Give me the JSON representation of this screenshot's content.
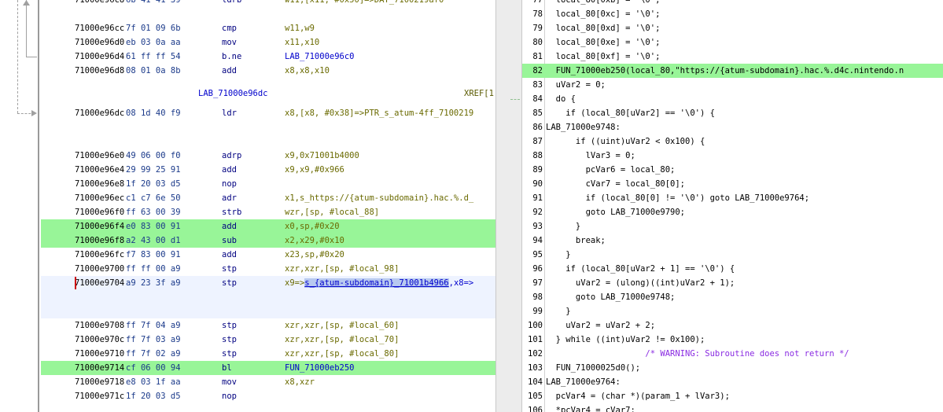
{
  "listing": {
    "rows": [
      {
        "addr": "71000e96c8",
        "bytes": "6b 41 41 39",
        "mn": "ldrb",
        "ops": "w11,[x11, #0x50]=>DAT_7100219af0",
        "hl": false
      },
      {
        "addr": "",
        "bytes": "",
        "mn": "",
        "ops": "",
        "hl": false
      },
      {
        "addr": "71000e96cc",
        "bytes": "7f 01 09 6b",
        "mn": "cmp",
        "ops": "w11,w9",
        "hl": false
      },
      {
        "addr": "71000e96d0",
        "bytes": "eb 03 0a aa",
        "mn": "mov",
        "ops": "x11,x10",
        "hl": false
      },
      {
        "addr": "71000e96d4",
        "bytes": "61 ff ff 54",
        "mn": "b.ne",
        "ops": "LAB_71000e96c0",
        "hl": false
      },
      {
        "addr": "71000e96d8",
        "bytes": "08 01 0a 8b",
        "mn": "add",
        "ops": "x8,x8,x10",
        "hl": false
      },
      {
        "addr": "",
        "bytes": "",
        "mn": "",
        "ops": "",
        "hl": false
      },
      {
        "addr": "",
        "bytes": "",
        "mn": "",
        "ops": "",
        "hl": false
      },
      {
        "addr": "71000e96dc",
        "bytes": "08 1d 40 f9",
        "mn": "ldr",
        "ops": "x8,[x8, #0x38]=>PTR_s_atum-4ff_7100219",
        "hl": false
      },
      {
        "addr": "",
        "bytes": "",
        "mn": "",
        "ops": "",
        "hl": false
      },
      {
        "addr": "",
        "bytes": "",
        "mn": "",
        "ops": "",
        "hl": false
      },
      {
        "addr": "71000e96e0",
        "bytes": "49 06 00 f0",
        "mn": "adrp",
        "ops": "x9,0x71001b4000",
        "hl": false
      },
      {
        "addr": "71000e96e4",
        "bytes": "29 99 25 91",
        "mn": "add",
        "ops": "x9,x9,#0x966",
        "hl": false
      },
      {
        "addr": "71000e96e8",
        "bytes": "1f 20 03 d5",
        "mn": "nop",
        "ops": "",
        "hl": false
      },
      {
        "addr": "71000e96ec",
        "bytes": "c1 c7 6e 50",
        "mn": "adr",
        "ops": "x1,s_https://{atum-subdomain}.hac.%.d_",
        "hl": false
      },
      {
        "addr": "71000e96f0",
        "bytes": "ff 63 00 39",
        "mn": "strb",
        "ops": "wzr,[sp, #local_88]",
        "hl": false
      },
      {
        "addr": "71000e96f4",
        "bytes": "e0 83 00 91",
        "mn": "add",
        "ops": "x0,sp,#0x20",
        "hl": true
      },
      {
        "addr": "71000e96f8",
        "bytes": "a2 43 00 d1",
        "mn": "sub",
        "ops": "x2,x29,#0x10",
        "hl": true
      },
      {
        "addr": "71000e96fc",
        "bytes": "f7 83 00 91",
        "mn": "add",
        "ops": "x23,sp,#0x20",
        "hl": false
      },
      {
        "addr": "71000e9700",
        "bytes": "ff ff 00 a9",
        "mn": "stp",
        "ops": "xzr,xzr,[sp, #local_98]",
        "hl": false
      },
      {
        "addr": "71000e9704",
        "bytes": "a9 23 3f a9",
        "mn": "stp",
        "ops": "",
        "hl": false
      },
      {
        "addr": "",
        "bytes": "",
        "mn": "",
        "ops": "",
        "hl": false
      },
      {
        "addr": "",
        "bytes": "",
        "mn": "",
        "ops": "",
        "hl": false
      },
      {
        "addr": "71000e9708",
        "bytes": "ff 7f 04 a9",
        "mn": "stp",
        "ops": "xzr,xzr,[sp, #local_60]",
        "hl": false
      },
      {
        "addr": "71000e970c",
        "bytes": "ff 7f 03 a9",
        "mn": "stp",
        "ops": "xzr,xzr,[sp, #local_70]",
        "hl": false
      },
      {
        "addr": "71000e9710",
        "bytes": "ff 7f 02 a9",
        "mn": "stp",
        "ops": "xzr,xzr,[sp, #local_80]",
        "hl": false
      },
      {
        "addr": "71000e9714",
        "bytes": "cf 06 00 94",
        "mn": "bl",
        "ops": "FUN_71000eb250",
        "hl": true
      },
      {
        "addr": "71000e9718",
        "bytes": "e8 03 1f aa",
        "mn": "mov",
        "ops": "x8,xzr",
        "hl": false
      },
      {
        "addr": "71000e971c",
        "bytes": "1f 20 03 d5",
        "mn": "nop",
        "ops": "",
        "hl": false
      }
    ],
    "label_row": {
      "label": "LAB_71000e96dc",
      "xref": "XREF[1"
    },
    "stp_row": {
      "pre": "x9=>",
      "sel": "s_{atum-subdomain}_71001b4966",
      "post": ",x8=>"
    }
  },
  "decompile": {
    "lines": [
      {
        "n": "77",
        "text": "  local_80[0xb] = '\\0';",
        "hl": false
      },
      {
        "n": "78",
        "text": "  local_80[0xc] = '\\0';",
        "hl": false
      },
      {
        "n": "79",
        "text": "  local_80[0xd] = '\\0';",
        "hl": false
      },
      {
        "n": "80",
        "text": "  local_80[0xe] = '\\0';",
        "hl": false
      },
      {
        "n": "81",
        "text": "  local_80[0xf] = '\\0';",
        "hl": false
      },
      {
        "n": "82",
        "text": "  FUN_71000eb250(local_80,\"https://{atum-subdomain}.hac.%.d4c.nintendo.n",
        "hl": true
      },
      {
        "n": "83",
        "text": "  uVar2 = 0;",
        "hl": false
      },
      {
        "n": "84",
        "text": "  do {",
        "hl": false
      },
      {
        "n": "85",
        "text": "    if (local_80[uVar2] == '\\0') {",
        "hl": false
      },
      {
        "n": "86",
        "text": "LAB_71000e9748:",
        "hl": false
      },
      {
        "n": "87",
        "text": "      if ((uint)uVar2 < 0x100) {",
        "hl": false
      },
      {
        "n": "88",
        "text": "        lVar3 = 0;",
        "hl": false
      },
      {
        "n": "89",
        "text": "        pcVar6 = local_80;",
        "hl": false
      },
      {
        "n": "90",
        "text": "        cVar7 = local_80[0];",
        "hl": false
      },
      {
        "n": "91",
        "text": "        if (local_80[0] != '\\0') goto LAB_71000e9764;",
        "hl": false
      },
      {
        "n": "92",
        "text": "        goto LAB_71000e9790;",
        "hl": false
      },
      {
        "n": "93",
        "text": "      }",
        "hl": false
      },
      {
        "n": "94",
        "text": "      break;",
        "hl": false
      },
      {
        "n": "95",
        "text": "    }",
        "hl": false
      },
      {
        "n": "96",
        "text": "    if (local_80[uVar2 + 1] == '\\0') {",
        "hl": false
      },
      {
        "n": "97",
        "text": "      uVar2 = (ulong)((int)uVar2 + 1);",
        "hl": false
      },
      {
        "n": "98",
        "text": "      goto LAB_71000e9748;",
        "hl": false
      },
      {
        "n": "99",
        "text": "    }",
        "hl": false
      },
      {
        "n": "100",
        "text": "    uVar2 = uVar2 + 2;",
        "hl": false
      },
      {
        "n": "101",
        "text": "  } while ((int)uVar2 != 0x100);",
        "hl": false
      },
      {
        "n": "102",
        "text": "                    /* WARNING: Subroutine does not return */",
        "hl": false
      },
      {
        "n": "103",
        "text": "  FUN_71000025d0();",
        "hl": false
      },
      {
        "n": "104",
        "text": "LAB_71000e9764:",
        "hl": false
      },
      {
        "n": "105",
        "text": "  pcVar4 = (char *)(param_1 + lVar3);",
        "hl": false
      },
      {
        "n": "106",
        "text": "  *pcVar4 = cVar7;",
        "hl": false
      }
    ]
  },
  "colors": {
    "highlight": "#98f598",
    "selection": "#b8c9f0",
    "label": "#0000cc",
    "comment": "#8a2be2"
  }
}
